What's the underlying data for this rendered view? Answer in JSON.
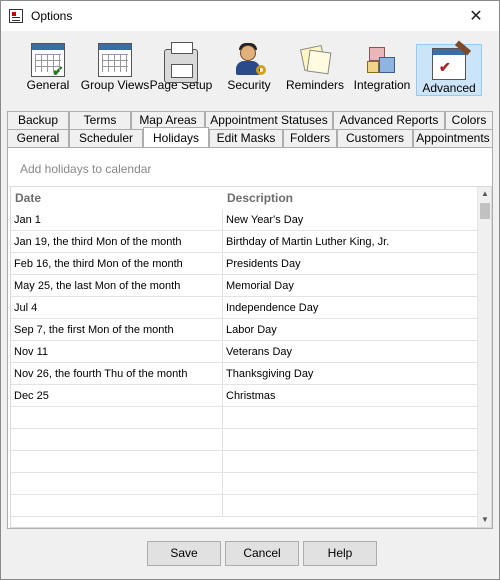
{
  "window": {
    "title": "Options",
    "close_glyph": "✕"
  },
  "toolbar": {
    "items": [
      {
        "label": "General",
        "icon": "calendar-check-icon"
      },
      {
        "label": "Group Views",
        "icon": "calendar-grid-icon"
      },
      {
        "label": "Page Setup",
        "icon": "printer-icon"
      },
      {
        "label": "Security",
        "icon": "user-key-icon"
      },
      {
        "label": "Reminders",
        "icon": "notes-icon"
      },
      {
        "label": "Integration",
        "icon": "cubes-icon"
      },
      {
        "label": "Advanced",
        "icon": "advanced-tools-icon"
      }
    ],
    "active": "Advanced"
  },
  "tabs": {
    "row1": [
      "Backup",
      "Terms",
      "Map Areas",
      "Appointment Statuses",
      "Advanced Reports",
      "Colors"
    ],
    "row2": [
      "General",
      "Scheduler",
      "Holidays",
      "Edit Masks",
      "Folders",
      "Customers",
      "Appointments"
    ],
    "selected": "Holidays"
  },
  "holidays": {
    "add_label": "Add holidays to calendar",
    "columns": [
      "Date",
      "Description"
    ],
    "rows": [
      {
        "date": "Jan 1",
        "description": "New Year's Day"
      },
      {
        "date": "Jan 19, the third Mon of the month",
        "description": "Birthday of Martin Luther King, Jr."
      },
      {
        "date": "Feb 16, the third Mon of the month",
        "description": "Presidents Day"
      },
      {
        "date": "May 25, the last Mon of the month",
        "description": "Memorial Day"
      },
      {
        "date": "Jul 4",
        "description": "Independence Day"
      },
      {
        "date": "Sep 7, the first Mon of the month",
        "description": "Labor Day"
      },
      {
        "date": "Nov 11",
        "description": "Veterans Day"
      },
      {
        "date": "Nov 26, the fourth Thu of the month",
        "description": "Thanksgiving Day"
      },
      {
        "date": "Dec 25",
        "description": "Christmas"
      }
    ]
  },
  "buttons": {
    "save": "Save",
    "cancel": "Cancel",
    "help": "Help"
  },
  "colors": {
    "active_toolbar_bg": "#cce4f7",
    "active_toolbar_border": "#99c9ef",
    "window_bg": "#f0f0f0"
  }
}
